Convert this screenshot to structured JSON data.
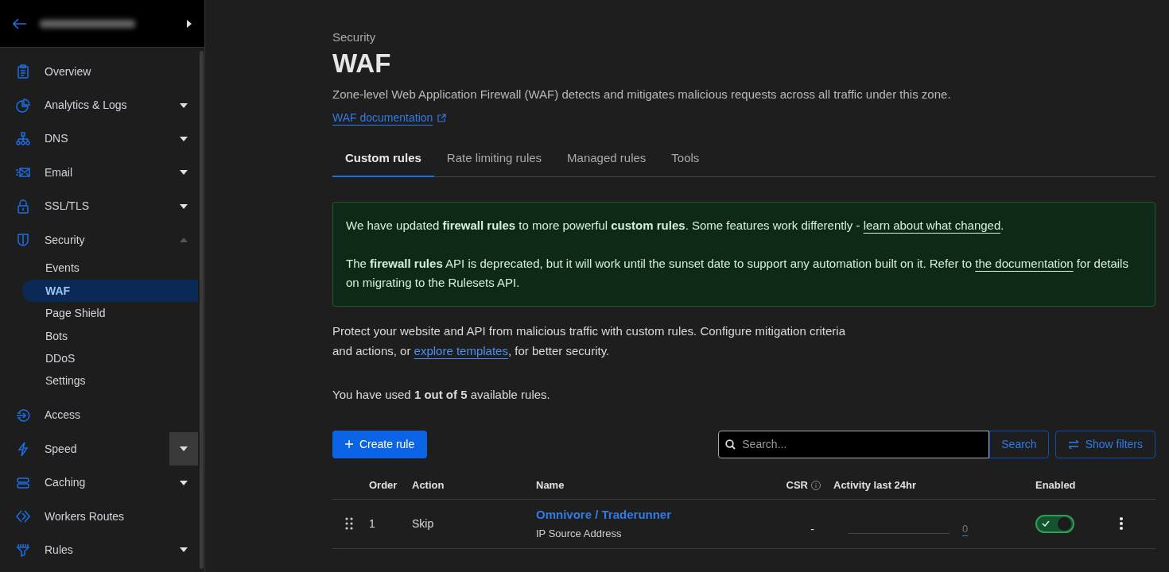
{
  "sidebar": {
    "items": [
      {
        "label": "Overview",
        "expandable": false,
        "expanded": false
      },
      {
        "label": "Analytics & Logs",
        "expandable": true,
        "expanded": false
      },
      {
        "label": "DNS",
        "expandable": true,
        "expanded": false
      },
      {
        "label": "Email",
        "expandable": true,
        "expanded": false
      },
      {
        "label": "SSL/TLS",
        "expandable": true,
        "expanded": false
      },
      {
        "label": "Security",
        "expandable": true,
        "expanded": true,
        "children": [
          {
            "label": "Events",
            "selected": false
          },
          {
            "label": "WAF",
            "selected": true
          },
          {
            "label": "Page Shield",
            "selected": false
          },
          {
            "label": "Bots",
            "selected": false
          },
          {
            "label": "DDoS",
            "selected": false
          },
          {
            "label": "Settings",
            "selected": false
          }
        ]
      },
      {
        "label": "Access",
        "expandable": false,
        "expanded": false
      },
      {
        "label": "Speed",
        "expandable": true,
        "expanded": false,
        "hovered": true
      },
      {
        "label": "Caching",
        "expandable": true,
        "expanded": false
      },
      {
        "label": "Workers Routes",
        "expandable": false,
        "expanded": false
      },
      {
        "label": "Rules",
        "expandable": true,
        "expanded": false
      }
    ]
  },
  "page": {
    "breadcrumb": "Security",
    "title": "WAF",
    "description": "Zone-level Web Application Firewall (WAF) detects and mitigates malicious requests across all traffic under this zone.",
    "doc_link": "WAF documentation"
  },
  "tabs": [
    {
      "label": "Custom rules",
      "selected": true
    },
    {
      "label": "Rate limiting rules",
      "selected": false
    },
    {
      "label": "Managed rules",
      "selected": false
    },
    {
      "label": "Tools",
      "selected": false
    }
  ],
  "notice": {
    "paragraphs": [
      [
        {
          "kind": "text",
          "text": "We have updated **firewall rules** to more powerful **custom rules**. Some features work differently - "
        },
        {
          "kind": "link",
          "text": "learn about what changed"
        },
        {
          "kind": "text",
          "text": "."
        }
      ],
      [
        {
          "kind": "text",
          "text": "The **firewall rules** API is deprecated, but it will work until the sunset date to support any automation built on it. Refer to "
        },
        {
          "kind": "link",
          "text": "the documentation"
        },
        {
          "kind": "text",
          "text": " for details on migrating to the Rulesets API."
        }
      ]
    ]
  },
  "intro": [
    {
      "kind": "text",
      "text": "Protect your website and API from malicious traffic with custom rules. Configure mitigation criteria and actions, or "
    },
    {
      "kind": "link",
      "text": "explore templates"
    },
    {
      "kind": "text",
      "text": ", for better security."
    }
  ],
  "usage": "You have used **1 out of 5** available rules.",
  "toolbar": {
    "create": "Create rule",
    "search_placeholder": "Search...",
    "search_button": "Search",
    "filters": "Show filters"
  },
  "table": {
    "columns": [
      "Order",
      "Action",
      "Name",
      "CSR",
      "Activity last 24hr",
      "Enabled"
    ],
    "rows": [
      {
        "order": "1",
        "action": "Skip",
        "name": "Omnivore / Traderunner",
        "subtitle": "IP Source Address",
        "csr": "-",
        "activity": "0",
        "enabled": true
      }
    ]
  }
}
